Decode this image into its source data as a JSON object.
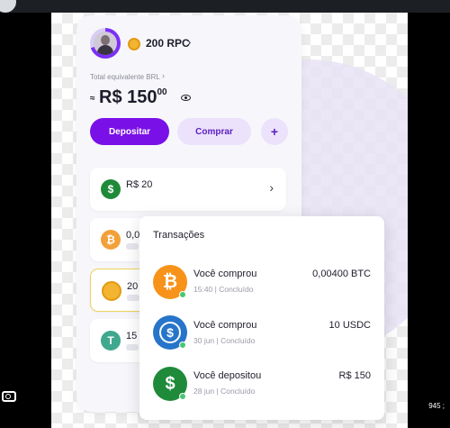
{
  "wallet": {
    "rpc_balance": "200 RPC",
    "equivalent_label": "Total equivalente BRL",
    "approx_symbol": "≈",
    "balance_main": "R$ 150",
    "balance_cents": "00"
  },
  "actions": {
    "deposit": "Depositar",
    "buy": "Comprar",
    "more": "+"
  },
  "assets": [
    {
      "icon": "dollar-icon",
      "text": "R$ 20",
      "color": "#1f8a3a"
    },
    {
      "icon": "bitcoin-icon",
      "text": "0,0",
      "color": "#f2a13a"
    },
    {
      "icon": "rpc-coin-icon",
      "text": "20",
      "color": "#f2b431"
    },
    {
      "icon": "tether-icon",
      "text": "15",
      "color": "#3fa88e"
    }
  ],
  "see_more": "V",
  "transactions": {
    "title": "Transações",
    "items": [
      {
        "icon": "bitcoin-icon",
        "color": "#f7931a",
        "title": "Você comprou",
        "sub": "15:40 | Concluído",
        "amount": "0,00400 BTC"
      },
      {
        "icon": "usdc-icon",
        "color": "#2775ca",
        "title": "Você comprou",
        "sub": "30 jun | Concluído",
        "amount": "10 USDC"
      },
      {
        "icon": "dollar-icon",
        "color": "#1f8a3a",
        "title": "Você depositou",
        "sub": "28 jun | Concluído",
        "amount": "R$ 150"
      }
    ]
  },
  "corner_text": "945 ;"
}
